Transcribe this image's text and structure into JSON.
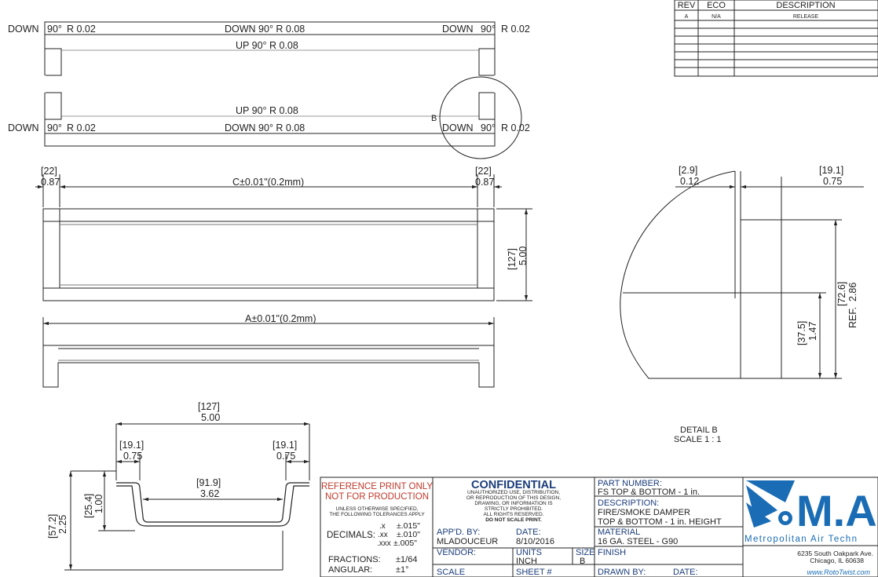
{
  "flat_view": {
    "top": {
      "left": "DOWN",
      "left_angle": "90°",
      "left_r": "R 0.02",
      "center": "DOWN  90°  R 0.08",
      "right": "DOWN",
      "right_angle": "90°",
      "right_r": "R 0.02",
      "inner": "UP  90°  R 0.08"
    },
    "bottom": {
      "left": "DOWN",
      "left_angle": "90°",
      "left_r": "R 0.02",
      "center": "DOWN  90°  R 0.08",
      "right": "DOWN",
      "right_angle": "90°",
      "right_r": "R 0.02",
      "inner": "UP  90°  R 0.08"
    },
    "detail_callout": "B"
  },
  "front_view": {
    "dim_left_mm": "[22]",
    "dim_left_in": "0.87",
    "dim_right_mm": "[22]",
    "dim_right_in": "0.87",
    "dim_c": "C±0.01\"(0.2mm)",
    "dim_height_mm": "[127]",
    "dim_height_in": "5.00"
  },
  "bottom_view": {
    "dim_a": "A±0.01\"(0.2mm)"
  },
  "detail_view": {
    "dim_gap_mm": "[2.9]",
    "dim_gap_in": "0.12",
    "dim_flange_mm": "[19.1]",
    "dim_flange_in": "0.75",
    "dim_ref_mm": "[72.6]",
    "dim_ref_in": "2.86",
    "dim_ref_label": "REF.",
    "dim_lower_mm": "[37.5]",
    "dim_lower_in": "1.47",
    "title": "DETAIL B",
    "scale": "SCALE 1 : 1"
  },
  "section_view": {
    "dim_width_mm": "[127]",
    "dim_width_in": "5.00",
    "dim_left_mm": "[19.1]",
    "dim_left_in": "0.75",
    "dim_right_mm": "[19.1]",
    "dim_right_in": "0.75",
    "dim_inner_mm": "[91.9]",
    "dim_inner_in": "3.62",
    "dim_small_mm": "[25.4]",
    "dim_small_in": "1.00",
    "dim_total_mm": "[57.2]",
    "dim_total_in": "2.25"
  },
  "revision_table": {
    "headers": [
      "REV",
      "ECO",
      "DESCRIPTION"
    ],
    "rows": [
      [
        "A",
        "N/A",
        "RELEASE"
      ]
    ]
  },
  "title_block": {
    "ref_line1": "REFERENCE PRINT ONLY",
    "ref_line2": "NOT FOR PRODUCTION",
    "tol_line1": "UNLESS OTHERWISE SPECIFIED,",
    "tol_line2": "THE FOLLOWING TOLERANCES APPLY",
    "decimals_label": "DECIMALS:",
    "dec_x": ".x",
    "dec_x_val": "±.015\"",
    "dec_xx": ".xx",
    "dec_xx_val": "±.010\"",
    "dec_xxx": ".xxx",
    "dec_xxx_val": "±.005\"",
    "fractions_label": "FRACTIONS:",
    "fractions_val": "±1/64",
    "angular_label": "ANGULAR:",
    "angular_val": "±1°",
    "confidential": "CONFIDENTIAL",
    "conf_lines": [
      "UNAUTHORIZED USE, DISTRIBUTION,",
      "OR REPRODUCTION OF THIS DESIGN,",
      "DRAWING, OR INFORMATION IS",
      "STRICTLY PROHIBITED.",
      "ALL RIGHTS RESERVED.",
      "DO NOT SCALE PRINT."
    ],
    "appd_label": "APP'D. BY:",
    "appd_val": "MLADOUCEUR",
    "date_label": "DATE:",
    "date_val": "8/10/2016",
    "vendor_label": "VENDOR:",
    "units_label": "UNITS",
    "units_val": "INCH",
    "size_label": "SIZE",
    "size_val": "B",
    "scale_label": "SCALE",
    "sheet_label": "SHEET #",
    "part_label": "PART NUMBER:",
    "part_val": "FS TOP & BOTTOM - 1 in.",
    "desc_label": "DESCRIPTION:",
    "desc_val1": "FIRE/SMOKE DAMPER",
    "desc_val2": "TOP & BOTTOM - 1 in. HEIGHT",
    "material_label": "MATERIAL",
    "material_val": "16 GA. STEEL - G90",
    "finish_label": "FINISH",
    "drawn_label": "DRAWN BY:",
    "drawn_date_label": "DATE:",
    "company_logo": "M.A",
    "company_name": "Metropolitan Air Techn",
    "address1": "6235 South Oakpark Ave.",
    "address2": "Chicago, IL 60638",
    "website": "www.RotoTwist.com"
  },
  "colors": {
    "line": "#222222",
    "red": "#c0392b",
    "brand": "#1a6db5"
  }
}
